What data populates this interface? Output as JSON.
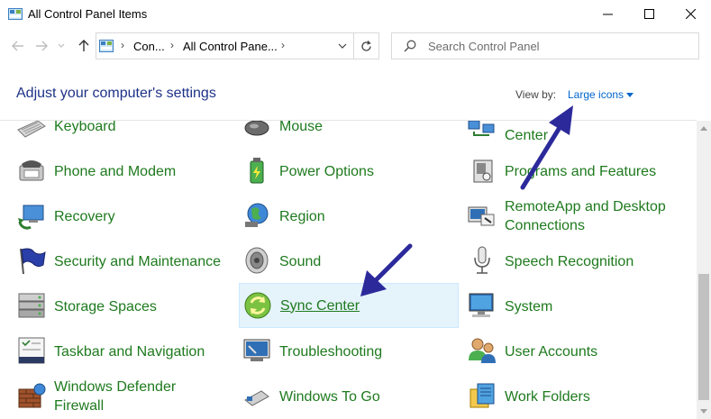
{
  "window": {
    "title": "All Control Panel Items"
  },
  "nav": {
    "crumbs": [
      "Con...",
      "All Control Pane..."
    ],
    "search_placeholder": "Search Control Panel"
  },
  "header": {
    "title": "Adjust your computer's settings",
    "view_by_label": "View by:",
    "view_by_value": "Large icons"
  },
  "items": [
    {
      "label": [
        "Keyboard"
      ],
      "icon": "keyboard-icon"
    },
    {
      "label": [
        "Mouse"
      ],
      "icon": "mouse-icon"
    },
    {
      "label": [
        "",
        "Center"
      ],
      "icon": "network-center-icon"
    },
    {
      "label": [
        "Phone and Modem"
      ],
      "icon": "phone-modem-icon"
    },
    {
      "label": [
        "Power Options"
      ],
      "icon": "power-options-icon"
    },
    {
      "label": [
        "Programs and Features"
      ],
      "icon": "programs-features-icon"
    },
    {
      "label": [
        "Recovery"
      ],
      "icon": "recovery-icon"
    },
    {
      "label": [
        "Region"
      ],
      "icon": "region-globe-icon"
    },
    {
      "label": [
        "RemoteApp and Desktop",
        "Connections"
      ],
      "icon": "remoteapp-icon"
    },
    {
      "label": [
        "Security and Maintenance"
      ],
      "icon": "security-flag-icon"
    },
    {
      "label": [
        "Sound"
      ],
      "icon": "speaker-icon"
    },
    {
      "label": [
        "Speech Recognition"
      ],
      "icon": "microphone-icon"
    },
    {
      "label": [
        "Storage Spaces"
      ],
      "icon": "storage-drives-icon"
    },
    {
      "label": [
        "Sync Center"
      ],
      "icon": "sync-icon",
      "selected": true
    },
    {
      "label": [
        "System"
      ],
      "icon": "system-monitor-icon"
    },
    {
      "label": [
        "Taskbar and Navigation"
      ],
      "icon": "taskbar-icon"
    },
    {
      "label": [
        "Troubleshooting"
      ],
      "icon": "troubleshooting-icon"
    },
    {
      "label": [
        "User Accounts"
      ],
      "icon": "user-accounts-icon"
    },
    {
      "label": [
        "Windows Defender",
        "Firewall"
      ],
      "icon": "firewall-icon"
    },
    {
      "label": [
        "Windows To Go"
      ],
      "icon": "usb-drive-icon"
    },
    {
      "label": [
        "Work Folders"
      ],
      "icon": "work-folders-icon"
    }
  ],
  "colors": {
    "link_green": "#1e7a1e",
    "header_blue": "#1e3287",
    "viewby_blue": "#0066cc",
    "annotation_arrow": "#2c2a9a",
    "selection_bg": "#e5f3fb"
  }
}
